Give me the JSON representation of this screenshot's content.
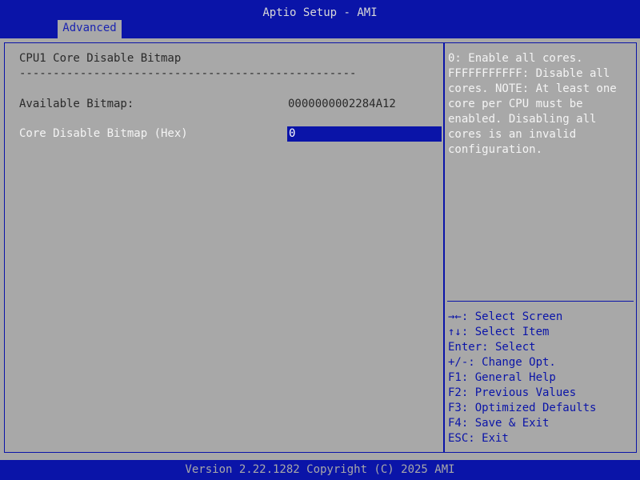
{
  "header": {
    "title": "Aptio Setup - AMI",
    "tabs": [
      {
        "label": "Advanced"
      }
    ]
  },
  "main": {
    "section_title": "CPU1 Core Disable Bitmap",
    "separator": "--------------------------------------------------",
    "available_bitmap": {
      "label": "Available Bitmap:",
      "value": "0000000002284A12"
    },
    "core_disable_bitmap": {
      "label": "Core Disable Bitmap (Hex)",
      "value": "0"
    }
  },
  "help": {
    "text": "0: Enable all cores.\nFFFFFFFFFFF: Disable all\ncores. NOTE: At least one\ncore per CPU must be\nenabled. Disabling all\ncores is an invalid\nconfiguration."
  },
  "keys": [
    {
      "label": "→←: Select Screen",
      "icon": "arrows-left-right-icon"
    },
    {
      "label": "↑↓: Select Item",
      "icon": "arrows-up-down-icon"
    },
    {
      "label": "Enter: Select"
    },
    {
      "label": "+/-: Change Opt."
    },
    {
      "label": "F1: General Help"
    },
    {
      "label": "F2: Previous Values"
    },
    {
      "label": "F3: Optimized Defaults"
    },
    {
      "label": "F4: Save & Exit"
    },
    {
      "label": "ESC: Exit"
    }
  ],
  "footer": {
    "text": "Version 2.22.1282 Copyright (C) 2025 AMI"
  },
  "colors": {
    "header_blue": "#0a14a8",
    "panel_gray": "#a8a8a8",
    "text_white": "#f4f4f4"
  }
}
